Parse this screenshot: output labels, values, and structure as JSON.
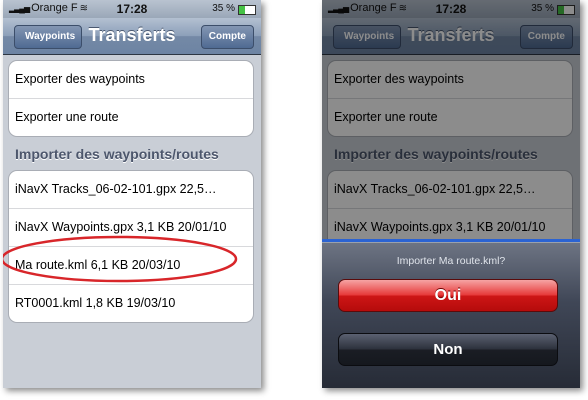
{
  "status": {
    "carrier": "Orange F",
    "time": "17:28",
    "battery": "35 %",
    "battery_level": 0.35
  },
  "nav": {
    "back_label": "Waypoints",
    "title": "Transferts",
    "right_label": "Compte"
  },
  "export_items": [
    "Exporter des waypoints",
    "Exporter une route"
  ],
  "import_header": "Importer des waypoints/routes",
  "import_items_left": [
    "iNavX Tracks_06-02-101.gpx 22,5…",
    "iNavX Waypoints.gpx 3,1 KB 20/01/10",
    "Ma route.kml 6,1 KB 20/03/10",
    "RT0001.kml 1,8 KB 19/03/10"
  ],
  "import_items_right": [
    "iNavX Tracks_06-02-101.gpx 22,5…",
    "iNavX Waypoints.gpx 3,1 KB 20/01/10"
  ],
  "action_sheet": {
    "title": "Importer Ma route.kml?",
    "yes": "Oui",
    "no": "Non"
  },
  "colors": {
    "highlight_oval": "#d8262a",
    "destructive": "#d21c1c",
    "nav_bar": "#6d84a3"
  }
}
